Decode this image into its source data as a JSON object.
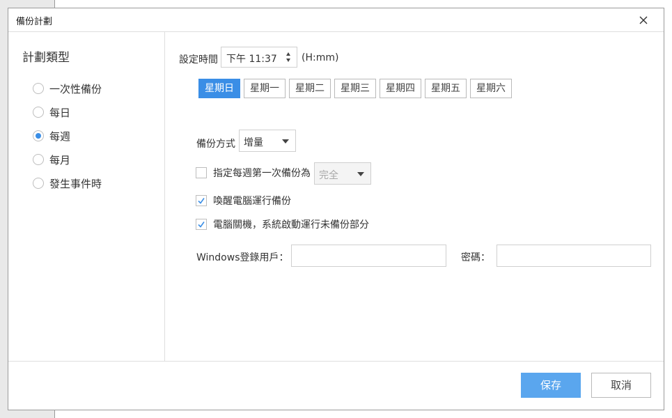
{
  "dialog": {
    "title": "備份計劃",
    "close_icon": "close-icon"
  },
  "sidebar": {
    "title": "計劃類型",
    "options": [
      {
        "label": "一次性備份",
        "checked": false
      },
      {
        "label": "每日",
        "checked": false
      },
      {
        "label": "每週",
        "checked": true
      },
      {
        "label": "每月",
        "checked": false
      },
      {
        "label": "發生事件時",
        "checked": false
      }
    ]
  },
  "schedule": {
    "time_label": "設定時間",
    "time_value": "下午 11:37",
    "time_format": "(H:mm)",
    "days": [
      {
        "label": "星期日",
        "active": true
      },
      {
        "label": "星期一",
        "active": false
      },
      {
        "label": "星期二",
        "active": false
      },
      {
        "label": "星期三",
        "active": false
      },
      {
        "label": "星期四",
        "active": false
      },
      {
        "label": "星期五",
        "active": false
      },
      {
        "label": "星期六",
        "active": false
      }
    ]
  },
  "backup": {
    "method_label": "備份方式",
    "method_value": "增量",
    "first_weekly_label": "指定每週第一次備份為",
    "first_weekly_value": "完全",
    "first_weekly_checked": false,
    "wake_label": "喚醒電腦運行備份",
    "wake_checked": true,
    "shutdown_label": "電腦關機，系統啟動運行未備份部分",
    "shutdown_checked": true
  },
  "login": {
    "user_label": "Windows登錄用戶：",
    "user_value": "",
    "password_label": "密碼：",
    "password_value": ""
  },
  "footer": {
    "save_label": "保存",
    "cancel_label": "取消"
  },
  "colors": {
    "accent": "#3a8ee6",
    "save_button": "#5aa6ee"
  }
}
